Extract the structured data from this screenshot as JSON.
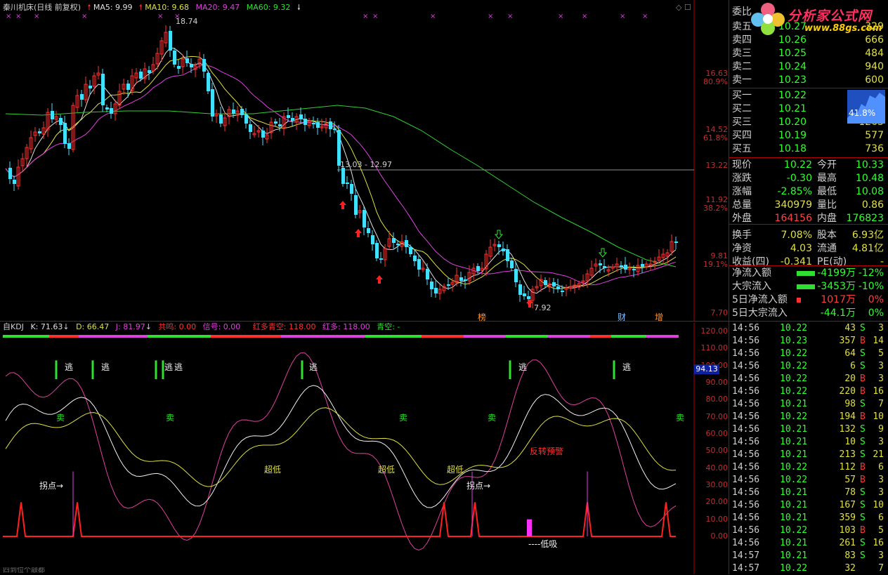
{
  "main_header": {
    "title": "秦川机床(日线 前复权)",
    "ma5": "MA5: 9.99",
    "ma10": "MA10: 9.68",
    "ma20": "MA20: 9.47",
    "ma60": "MA60: 9.32"
  },
  "main_axis": {
    "labels": [
      "16.63",
      "80.9%",
      "14.52",
      "61.8%",
      "13.22",
      "11.92",
      "38.2%",
      "9.81",
      "19.1%",
      "7.70"
    ],
    "high_label": "18.74",
    "low_label": "7.92",
    "range_label": "13.03 - 12.97"
  },
  "main_markers": {
    "bang": "榜",
    "cai": "财",
    "zeng": "增"
  },
  "kdj_header": {
    "name": "自KDJ",
    "k": "K: 71.63",
    "d": "D: 66.47",
    "j": "J: 81.97",
    "gongming": "共鸣: 0.00",
    "signal": "信号: 0.00",
    "hongduo_qingkong": "红多青空: 118.00",
    "hongduo": "红多: 118.00",
    "qingkong": "青空: -"
  },
  "kdj_axis": {
    "labels": [
      "120.00",
      "110.00",
      "100.00",
      "90.00",
      "80.00",
      "70.00",
      "60.00",
      "50.00",
      "40.00",
      "30.00",
      "20.00",
      "10.00",
      "0.00"
    ],
    "current": "94.13"
  },
  "kdj_labels": {
    "tao": "逃",
    "mai": "卖",
    "chaodi": "超低",
    "guaidian": "拐点→",
    "fanzhuan": "反转预警",
    "dixi": "----低吸"
  },
  "order_book": {
    "wei_bi": "委比",
    "sell": [
      {
        "label": "卖五",
        "price": "10.27",
        "vol": "329"
      },
      {
        "label": "卖四",
        "price": "10.26",
        "vol": "666"
      },
      {
        "label": "卖三",
        "price": "10.25",
        "vol": "484"
      },
      {
        "label": "卖二",
        "price": "10.24",
        "vol": "940"
      },
      {
        "label": "卖一",
        "price": "10.23",
        "vol": "600"
      }
    ],
    "buy": [
      {
        "label": "买一",
        "price": "10.22",
        "vol": ""
      },
      {
        "label": "买二",
        "price": "10.21",
        "vol": ""
      },
      {
        "label": "买三",
        "price": "10.20",
        "vol": "1265"
      },
      {
        "label": "买四",
        "price": "10.19",
        "vol": "577"
      },
      {
        "label": "买五",
        "price": "10.18",
        "vol": "736"
      }
    ],
    "mini_pct": "41.8%"
  },
  "stats": [
    {
      "l1": "现价",
      "v1": "10.22",
      "c1": "#30ff30",
      "l2": "今开",
      "v2": "10.33",
      "c2": "#30ff30"
    },
    {
      "l1": "涨跌",
      "v1": "-0.30",
      "c1": "#30ff30",
      "l2": "最高",
      "v2": "10.48",
      "c2": "#30ff30"
    },
    {
      "l1": "涨幅",
      "v1": "-2.85%",
      "c1": "#30ff30",
      "l2": "最低",
      "v2": "10.08",
      "c2": "#30ff30"
    },
    {
      "l1": "总量",
      "v1": "340979",
      "c1": "#e0e040",
      "l2": "量比",
      "v2": "0.86",
      "c2": "#e0e040"
    },
    {
      "l1": "外盘",
      "v1": "164156",
      "c1": "#ff4040",
      "l2": "内盘",
      "v2": "176823",
      "c2": "#30ff30"
    },
    {
      "l1": "换手",
      "v1": "7.08%",
      "c1": "#e0e040",
      "l2": "股本",
      "v2": "6.93亿",
      "c2": "#e0e040"
    },
    {
      "l1": "净资",
      "v1": "4.03",
      "c1": "#e0e040",
      "l2": "流通",
      "v2": "4.81亿",
      "c2": "#e0e040"
    },
    {
      "l1": "收益(四)",
      "v1": "-0.341",
      "c1": "#e0e040",
      "l2": "PE(动)",
      "v2": "-",
      "c2": "#e0e040"
    }
  ],
  "flows": [
    {
      "label": "净流入额",
      "value": "-4199万",
      "pct": "-12%",
      "color": "#30ff30"
    },
    {
      "label": "大宗流入",
      "value": "-3453万",
      "pct": "-10%",
      "color": "#30ff30"
    },
    {
      "label": "5日净流入额",
      "value": "1017万",
      "pct": "0%",
      "color": "#ff4040"
    },
    {
      "label": "5日大宗流入",
      "value": "-44.1万",
      "pct": "0%",
      "color": "#30ff30"
    }
  ],
  "ticks": [
    {
      "t": "14:56",
      "p": "10.22",
      "v": "43",
      "s": "S",
      "n": "3"
    },
    {
      "t": "14:56",
      "p": "10.23",
      "v": "357",
      "s": "B",
      "n": "14"
    },
    {
      "t": "14:56",
      "p": "10.22",
      "v": "64",
      "s": "S",
      "n": "5"
    },
    {
      "t": "14:56",
      "p": "10.22",
      "v": "6",
      "s": "S",
      "n": "3"
    },
    {
      "t": "14:56",
      "p": "10.22",
      "v": "20",
      "s": "B",
      "n": "3"
    },
    {
      "t": "14:56",
      "p": "10.22",
      "v": "220",
      "s": "B",
      "n": "16"
    },
    {
      "t": "14:56",
      "p": "10.21",
      "v": "98",
      "s": "S",
      "n": "7"
    },
    {
      "t": "14:56",
      "p": "10.22",
      "v": "194",
      "s": "B",
      "n": "10"
    },
    {
      "t": "14:56",
      "p": "10.21",
      "v": "132",
      "s": "S",
      "n": "9"
    },
    {
      "t": "14:56",
      "p": "10.21",
      "v": "10",
      "s": "S",
      "n": "3"
    },
    {
      "t": "14:56",
      "p": "10.21",
      "v": "213",
      "s": "S",
      "n": "21"
    },
    {
      "t": "14:56",
      "p": "10.22",
      "v": "112",
      "s": "B",
      "n": "6"
    },
    {
      "t": "14:56",
      "p": "10.22",
      "v": "57",
      "s": "B",
      "n": "3"
    },
    {
      "t": "14:56",
      "p": "10.21",
      "v": "78",
      "s": "S",
      "n": "3"
    },
    {
      "t": "14:56",
      "p": "10.21",
      "v": "167",
      "s": "S",
      "n": "10"
    },
    {
      "t": "14:56",
      "p": "10.21",
      "v": "359",
      "s": "S",
      "n": "6"
    },
    {
      "t": "14:56",
      "p": "10.22",
      "v": "103",
      "s": "B",
      "n": "5"
    },
    {
      "t": "14:56",
      "p": "10.21",
      "v": "261",
      "s": "S",
      "n": "16"
    },
    {
      "t": "14:57",
      "p": "10.21",
      "v": "83",
      "s": "S",
      "n": "3"
    },
    {
      "t": "14:57",
      "p": "10.22",
      "v": "32",
      "s": "",
      "n": "7"
    }
  ],
  "logo": {
    "brand": "分析家公式网",
    "url": "www.88gs.com"
  },
  "bottom_text": "四到位个敲都"
}
